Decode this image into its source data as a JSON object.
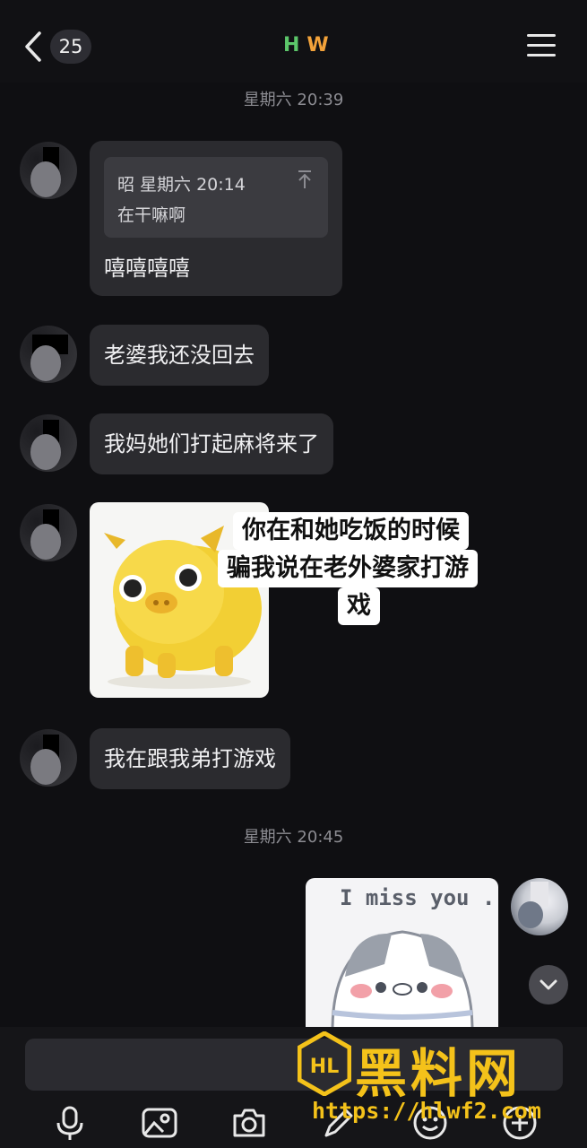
{
  "header": {
    "back_icon": "chevron-left-icon",
    "unread_count": "25",
    "peer_name_h": "H",
    "peer_name_w": "W",
    "menu_icon": "hamburger-menu-icon"
  },
  "timestamps": [
    "星期六 20:39",
    "星期六 20:45"
  ],
  "messages": [
    {
      "type": "quote",
      "quote_meta": "昭  星期六 20:14",
      "quote_text": "在干嘛啊",
      "quote_icon": "pin-top-icon",
      "text": "嘻嘻嘻嘻"
    },
    {
      "type": "text",
      "text": "老婆我还没回去"
    },
    {
      "type": "text",
      "text": "我妈她们打起麻将来了"
    },
    {
      "type": "sticker",
      "image": "yellow-pig-sticker",
      "captions": [
        "你在和她吃饭的时候",
        "骗我说在老外婆家打游",
        "戏"
      ]
    },
    {
      "type": "text",
      "text": "我在跟我弟打游戏"
    },
    {
      "type": "sticker",
      "side": "right",
      "image": "crying-cat-sticker",
      "caption": "I miss you ."
    }
  ],
  "scroll_button": {
    "icon": "chevron-down-icon"
  },
  "toolbar": {
    "icons": [
      "microphone-icon",
      "image-icon",
      "camera-icon",
      "pencil-icon",
      "emoji-icon",
      "plus-icon"
    ]
  },
  "watermark": {
    "text": "黑料网",
    "url": "https://hlwf2.com"
  }
}
